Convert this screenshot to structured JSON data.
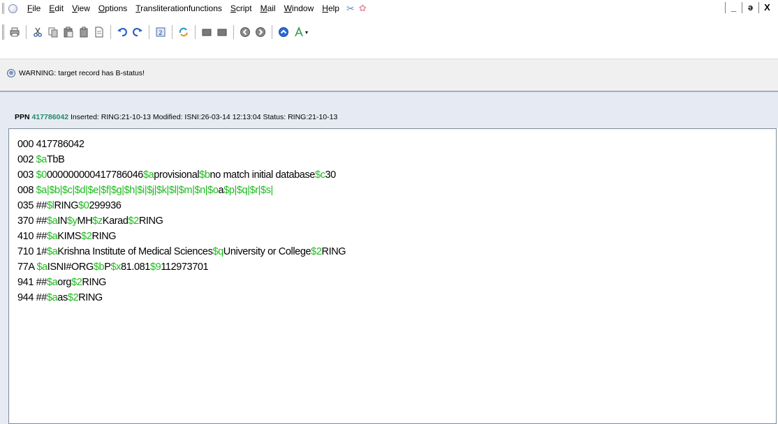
{
  "menubar": {
    "items": [
      {
        "accel": "F",
        "rest": "ile"
      },
      {
        "accel": "E",
        "rest": "dit"
      },
      {
        "accel": "V",
        "rest": "iew"
      },
      {
        "accel": "O",
        "rest": "ptions"
      },
      {
        "accel": "T",
        "rest": "ransliterationfunctions"
      },
      {
        "accel": "S",
        "rest": "cript"
      },
      {
        "accel": "M",
        "rest": "ail"
      },
      {
        "accel": "W",
        "rest": "indow"
      },
      {
        "accel": "H",
        "rest": "elp"
      }
    ],
    "window_controls": {
      "minimize": "_",
      "restore": "ə",
      "close": "X"
    }
  },
  "warning": {
    "text": "WARNING: target record has B-status!"
  },
  "ppn": {
    "label": "PPN",
    "value": "417786042",
    "meta": " Inserted: RING:21-10-13 Modified: ISNI:26-03-14 12:13:04 Status: RING:21-10-13"
  },
  "record": {
    "lines": [
      [
        {
          "t": "000 417786042",
          "sf": false
        }
      ],
      [
        {
          "t": "002 ",
          "sf": false
        },
        {
          "t": "$a",
          "sf": true
        },
        {
          "t": "TbB",
          "sf": false
        }
      ],
      [
        {
          "t": "003 ",
          "sf": false
        },
        {
          "t": "$0",
          "sf": true
        },
        {
          "t": "000000000417786046",
          "sf": false
        },
        {
          "t": "$a",
          "sf": true
        },
        {
          "t": "provisional",
          "sf": false
        },
        {
          "t": "$b",
          "sf": true
        },
        {
          "t": "no match initial database",
          "sf": false
        },
        {
          "t": "$c",
          "sf": true
        },
        {
          "t": "30",
          "sf": false
        }
      ],
      [
        {
          "t": "008 ",
          "sf": false
        },
        {
          "t": "$a|$b|$c|$d|$e|$f|$g|$h|$i|$j|$k|$l|$m|$n|$o",
          "sf": true
        },
        {
          "t": "a",
          "sf": false
        },
        {
          "t": "$p|$q|$r|$s|",
          "sf": true
        }
      ],
      [
        {
          "t": "035 ##",
          "sf": false
        },
        {
          "t": "$l",
          "sf": true
        },
        {
          "t": "RING",
          "sf": false
        },
        {
          "t": "$0",
          "sf": true
        },
        {
          "t": "299936",
          "sf": false
        }
      ],
      [
        {
          "t": "370 ##",
          "sf": false
        },
        {
          "t": "$a",
          "sf": true
        },
        {
          "t": "IN",
          "sf": false
        },
        {
          "t": "$y",
          "sf": true
        },
        {
          "t": "MH",
          "sf": false
        },
        {
          "t": "$z",
          "sf": true
        },
        {
          "t": "Karad",
          "sf": false
        },
        {
          "t": "$2",
          "sf": true
        },
        {
          "t": "RING",
          "sf": false
        }
      ],
      [
        {
          "t": "410 ##",
          "sf": false
        },
        {
          "t": "$a",
          "sf": true
        },
        {
          "t": "KIMS",
          "sf": false
        },
        {
          "t": "$2",
          "sf": true
        },
        {
          "t": "RING",
          "sf": false
        }
      ],
      [
        {
          "t": "710 1#",
          "sf": false
        },
        {
          "t": "$a",
          "sf": true
        },
        {
          "t": "Krishna Institute of Medical Sciences",
          "sf": false
        },
        {
          "t": "$q",
          "sf": true
        },
        {
          "t": "University or College",
          "sf": false
        },
        {
          "t": "$2",
          "sf": true
        },
        {
          "t": "RING",
          "sf": false
        }
      ],
      [
        {
          "t": "77A ",
          "sf": false
        },
        {
          "t": "$a",
          "sf": true
        },
        {
          "t": "ISNI#ORG",
          "sf": false
        },
        {
          "t": "$b",
          "sf": true
        },
        {
          "t": "P",
          "sf": false
        },
        {
          "t": "$x",
          "sf": true
        },
        {
          "t": "81.081",
          "sf": false
        },
        {
          "t": "$9",
          "sf": true
        },
        {
          "t": "112973701",
          "sf": false
        }
      ],
      [
        {
          "t": "941 ##",
          "sf": false
        },
        {
          "t": "$a",
          "sf": true
        },
        {
          "t": "org",
          "sf": false
        },
        {
          "t": "$2",
          "sf": true
        },
        {
          "t": "RING",
          "sf": false
        }
      ],
      [
        {
          "t": "944 ##",
          "sf": false
        },
        {
          "t": "$a",
          "sf": true
        },
        {
          "t": "as",
          "sf": false
        },
        {
          "t": "$2",
          "sf": true
        },
        {
          "t": "RING",
          "sf": false
        }
      ]
    ]
  },
  "colors": {
    "subfield": "#1dbb1d",
    "ppn_value": "#1f8a6b",
    "header_bg": "#e6ebf3"
  },
  "toolbar": {
    "icons": [
      "print-icon",
      "cut-icon",
      "copy-icon",
      "paste-icon",
      "document-icon",
      "undo-icon",
      "redo-icon",
      "save-record-icon",
      "refresh-icon",
      "stop-icon",
      "stop-icon",
      "back-icon",
      "forward-icon",
      "up-icon",
      "translit-icon"
    ]
  }
}
